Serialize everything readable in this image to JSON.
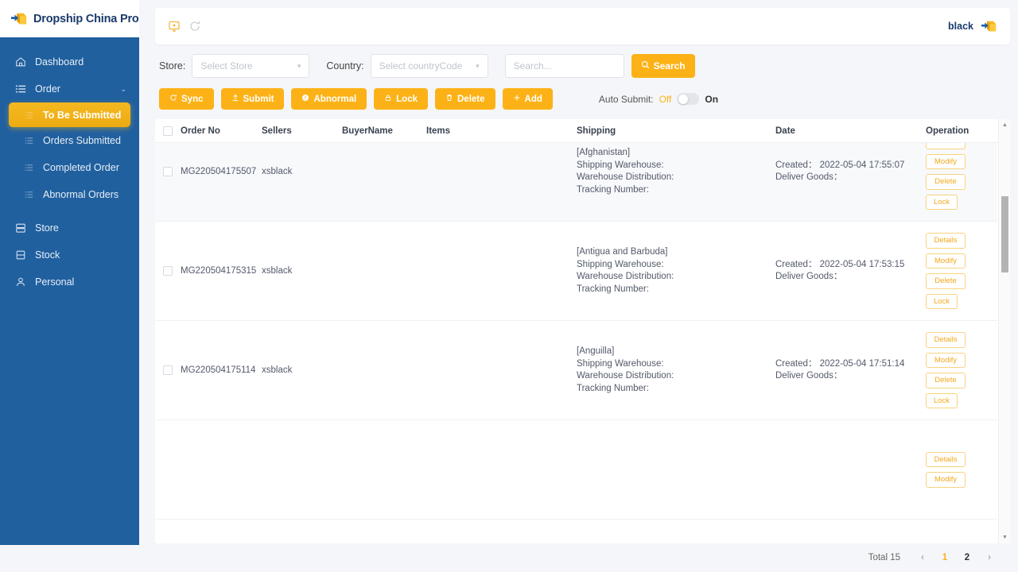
{
  "brand": {
    "name": "Dropship China Pro",
    "logo_icon": "cube-box-icon"
  },
  "colors": {
    "sidebar_bg": "#20609f",
    "accent": "#fcb216",
    "active_nav": "#f5b820",
    "brand_text": "#1b3a6b"
  },
  "sidebar": {
    "items": [
      {
        "label": "Dashboard",
        "icon": "home-icon",
        "level": "top"
      },
      {
        "label": "Order",
        "icon": "list-icon",
        "level": "top",
        "chevron": "⌄"
      },
      {
        "label": "To Be Submitted",
        "icon": "list-sub-icon",
        "level": "sub",
        "active": true
      },
      {
        "label": "Orders Submitted",
        "icon": "list-sub-icon",
        "level": "sub"
      },
      {
        "label": "Completed Order",
        "icon": "list-sub-icon",
        "level": "sub"
      },
      {
        "label": "Abnormal Orders",
        "icon": "list-sub-icon",
        "level": "sub"
      },
      {
        "label": "Store",
        "icon": "store-icon",
        "level": "top"
      },
      {
        "label": "Stock",
        "icon": "database-icon",
        "level": "top"
      },
      {
        "label": "Personal",
        "icon": "user-icon",
        "level": "top"
      }
    ]
  },
  "topbar": {
    "left_icons": [
      {
        "name": "screen-monitor-icon",
        "color": "#f0a91c"
      },
      {
        "name": "refresh-icon",
        "color": "#c8ccd2"
      }
    ],
    "user_name": "black",
    "user_logo_icon": "cube-box-icon"
  },
  "filters": {
    "store_label": "Store:",
    "store_placeholder": "Select Store",
    "country_label": "Country:",
    "country_placeholder": "Select countryCode",
    "search_placeholder": "Search...",
    "search_button": "Search",
    "search_button_icon": "search-icon"
  },
  "actions": {
    "buttons": [
      {
        "label": "Sync",
        "icon": "refresh-icon"
      },
      {
        "label": "Submit",
        "icon": "upload-icon"
      },
      {
        "label": "Abnormal",
        "icon": "exclamation-circle-icon"
      },
      {
        "label": "Lock",
        "icon": "lock-icon"
      },
      {
        "label": "Delete",
        "icon": "trash-icon"
      },
      {
        "label": "Add",
        "icon": "plus-icon"
      }
    ],
    "auto_submit_label": "Auto Submit:",
    "auto_submit_off": "Off",
    "auto_submit_on": "On",
    "auto_submit_state": "off"
  },
  "table": {
    "columns": [
      "Order No",
      "Sellers",
      "BuyerName",
      "Items",
      "Shipping",
      "Date",
      "Operation"
    ],
    "ship_labels": {
      "warehouse": "Shipping Warehouse:",
      "distribution": "Warehouse Distribution:",
      "tracking": "Tracking Number:"
    },
    "date_labels": {
      "created": "Created：",
      "deliver": "Deliver Goods："
    },
    "op_buttons": [
      "Details",
      "Modify",
      "Delete",
      "Lock"
    ],
    "rows": [
      {
        "order_no": "MG220504175507",
        "seller": "xsblack",
        "buyer_name": "",
        "items": "",
        "country": "[Afghanistan]",
        "warehouse": "",
        "distribution": "",
        "tracking": "",
        "created": "2022-05-04 17:55:07",
        "deliver": ""
      },
      {
        "order_no": "MG220504175315",
        "seller": "xsblack",
        "buyer_name": "",
        "items": "",
        "country": "[Antigua and Barbuda]",
        "warehouse": "",
        "distribution": "",
        "tracking": "",
        "created": "2022-05-04 17:53:15",
        "deliver": ""
      },
      {
        "order_no": "MG220504175114",
        "seller": "xsblack",
        "buyer_name": "",
        "items": "",
        "country": "[Anguilla]",
        "warehouse": "",
        "distribution": "",
        "tracking": "",
        "created": "2022-05-04 17:51:14",
        "deliver": ""
      }
    ]
  },
  "pagination": {
    "total_text": "Total 15",
    "prev": "‹",
    "next": "›",
    "pages": [
      "1",
      "2"
    ],
    "current": "1"
  }
}
